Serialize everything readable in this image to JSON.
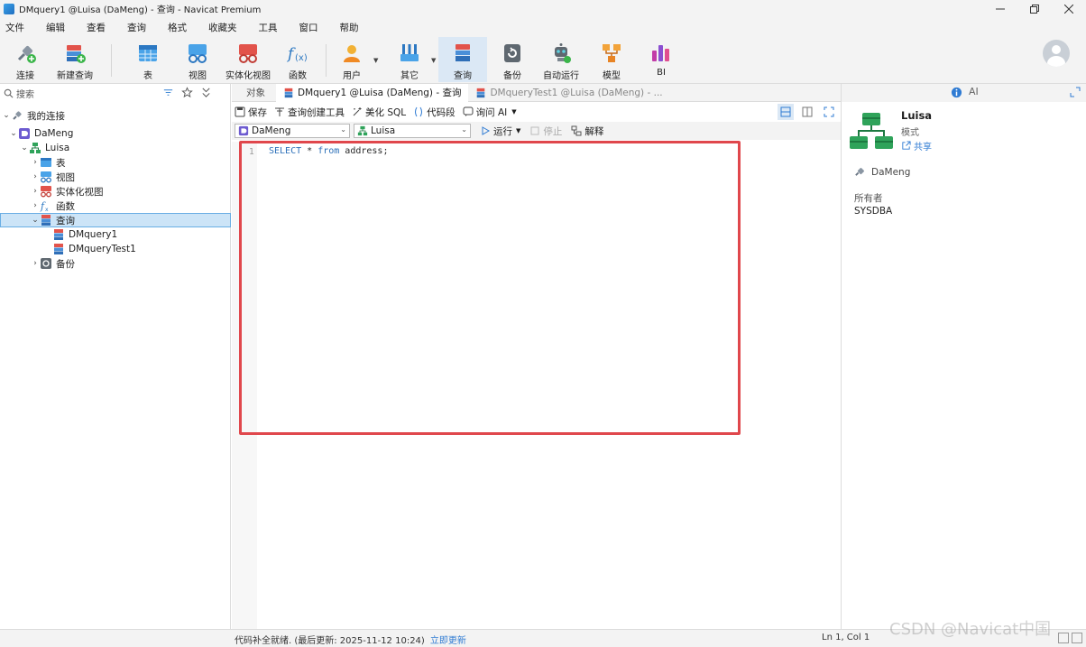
{
  "window": {
    "title": "DMquery1 @Luisa (DaMeng) - 查询 - Navicat Premium",
    "minimize": "✕",
    "maximize": "—",
    "restore": "❐",
    "close": "✕"
  },
  "menu": [
    "文件",
    "编辑",
    "查看",
    "查询",
    "格式",
    "收藏夹",
    "工具",
    "窗口",
    "帮助"
  ],
  "toolbar": {
    "connect": "连接",
    "new_query": "新建查询",
    "table": "表",
    "view": "视图",
    "mat_view": "实体化视图",
    "function": "函数",
    "user": "用户",
    "other": "其它",
    "query": "查询",
    "backup": "备份",
    "autorun": "自动运行",
    "model": "模型",
    "bi": "BI"
  },
  "left": {
    "search_placeholder": "搜索",
    "tree": [
      {
        "label": "我的连接"
      },
      {
        "label": "DaMeng"
      },
      {
        "label": "Luisa"
      },
      {
        "label": "表"
      },
      {
        "label": "视图"
      },
      {
        "label": "实体化视图"
      },
      {
        "label": "函数"
      },
      {
        "label": "查询"
      },
      {
        "label": "DMquery1"
      },
      {
        "label": "DMqueryTest1"
      },
      {
        "label": "备份"
      }
    ]
  },
  "tabs": {
    "objects": "对象",
    "active": "DMquery1 @Luisa (DaMeng) - 查询",
    "inactive": "DMqueryTest1 @Luisa (DaMeng) - ..."
  },
  "qtoolbar": {
    "save": "保存",
    "builder": "查询创建工具",
    "beautify": "美化 SQL",
    "snippet": "代码段",
    "ask_ai": "询问 AI"
  },
  "selectors": {
    "connection": "DaMeng",
    "schema": "Luisa",
    "run": "运行",
    "stop": "停止",
    "explain": "解释"
  },
  "editor": {
    "line_number": "1",
    "kw_select": "SELECT",
    "star": " * ",
    "kw_from": "from",
    "rest": " address;"
  },
  "right": {
    "ai_label": "AI",
    "name": "Luisa",
    "type": "模式",
    "share": "共享",
    "connection": "DaMeng",
    "owner_label": "所有者",
    "owner_value": "SYSDBA"
  },
  "status": {
    "text": "代码补全就绪. (最后更新: 2025-11-12 10:24)",
    "link": "立即更新",
    "position": "Ln 1, Col 1",
    "watermark": "CSDN @Navicat中国"
  },
  "colors": {
    "accent": "#2f7bd3",
    "highlight_border": "#e0474c",
    "selected_row": "#cce4f7"
  }
}
